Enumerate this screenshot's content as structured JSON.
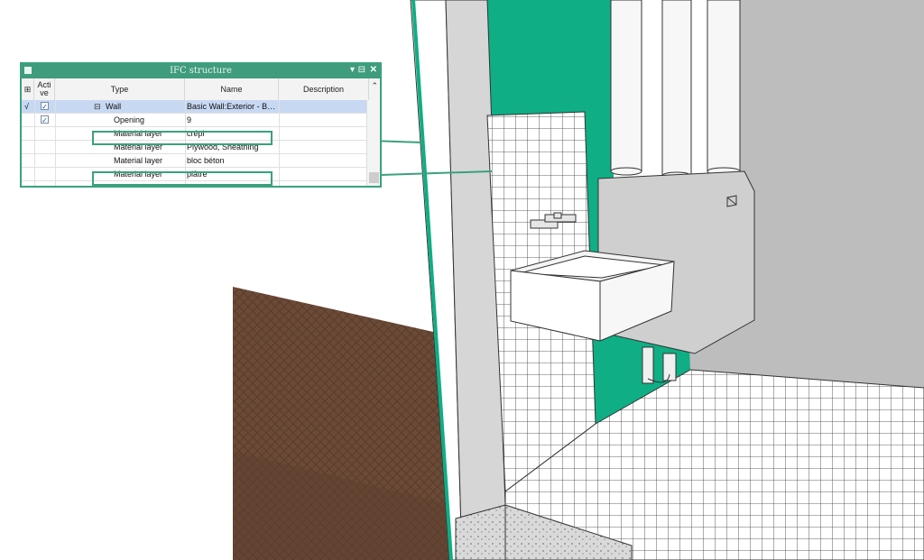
{
  "panel": {
    "title": "IFC structure",
    "controls": {
      "dropdown": "▾",
      "dock": "⊟",
      "close": "✕"
    },
    "header": {
      "filter_icon": "⊞",
      "active": "Acti\nve",
      "type": "Type",
      "name": "Name",
      "description": "Description"
    },
    "rows": [
      {
        "mark": "√",
        "active": true,
        "expander": "⊟",
        "type": "Wall",
        "name": "Basic Wall:Exterior - B…",
        "selected": true
      },
      {
        "mark": "",
        "active": true,
        "expander": "",
        "type": "Opening",
        "name": "9",
        "selected": false
      },
      {
        "mark": "",
        "active": false,
        "expander": "",
        "type": "Material layer",
        "name": "crépi",
        "selected": false
      },
      {
        "mark": "",
        "active": false,
        "expander": "",
        "type": "Material layer",
        "name": "Plywood, Sheathing",
        "selected": false
      },
      {
        "mark": "",
        "active": false,
        "expander": "",
        "type": "Material layer",
        "name": "bloc béton",
        "selected": false
      },
      {
        "mark": "",
        "active": false,
        "expander": "",
        "type": "Material layer",
        "name": "plâtre",
        "selected": false
      }
    ]
  },
  "colors": {
    "accent_green": "#3aa17e",
    "wall_green": "#0fae84",
    "floor_brown": "#6b4a37",
    "grey_wall": "#bdbdbd"
  }
}
